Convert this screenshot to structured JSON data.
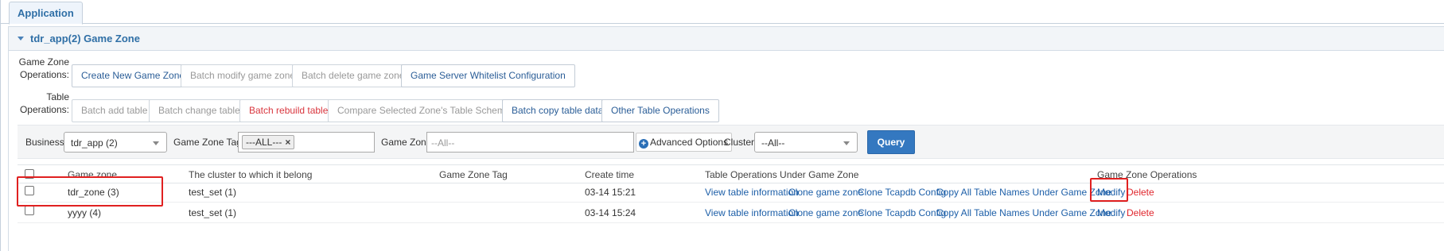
{
  "tab": {
    "label": "Application"
  },
  "panel": {
    "title": "tdr_app(2) Game Zone"
  },
  "game_zone_ops": {
    "label_line1": "Game Zone",
    "label_line2": "Operations:",
    "buttons": [
      {
        "label": "Create New Game Zone",
        "state": "enabled"
      },
      {
        "label": "Batch modify game zone",
        "state": "disabled"
      },
      {
        "label": "Batch delete game zone",
        "state": "disabled"
      },
      {
        "label": "Game Server Whitelist Configuration",
        "state": "enabled"
      }
    ]
  },
  "table_ops": {
    "label_line1": "Table",
    "label_line2": "Operations:",
    "buttons": [
      {
        "label": "Batch add table",
        "state": "disabled"
      },
      {
        "label": "Batch change table",
        "state": "disabled"
      },
      {
        "label": "Batch rebuild table",
        "state": "danger"
      },
      {
        "label": "Compare Selected Zone's Table Schemas",
        "state": "disabled"
      },
      {
        "label": "Batch copy table data",
        "state": "enabled"
      },
      {
        "label": "Other Table Operations",
        "state": "enabled"
      }
    ]
  },
  "filters": {
    "business_label": "Business:",
    "business_value": "tdr_app (2)",
    "tag_label": "Game Zone Tag:",
    "tag_chip": "---ALL---",
    "tag_chip_remove": "×",
    "zone_label": "Game Zone:",
    "zone_placeholder": "--All--",
    "advanced_label": "Advanced Options",
    "advanced_icon": "+",
    "cluster_label": "Cluster:",
    "cluster_value": "--All--",
    "query_label": "Query"
  },
  "table": {
    "headers": {
      "zone": "Game zone",
      "cluster": "The cluster to which it belong",
      "tag": "Game Zone Tag",
      "created": "Create time",
      "table_ops": "Table Operations Under Game Zone",
      "zone_ops": "Game Zone Operations"
    },
    "rows": [
      {
        "zone": "tdr_zone (3)",
        "cluster": "test_set (1)",
        "tag": "",
        "created": "03-14 15:21",
        "view": "View table information",
        "clone": "Clone game zone",
        "clone_tcapdb": "Clone Tcapdb Config",
        "copy_names": "Copy All Table Names Under Game Zone",
        "modify": "Modify",
        "delete": "Delete"
      },
      {
        "zone": "yyyy (4)",
        "cluster": "test_set (1)",
        "tag": "",
        "created": "03-14 15:24",
        "view": "View table information",
        "clone": "Clone game zone",
        "clone_tcapdb": "Clone Tcapdb Config",
        "copy_names": "Copy All Table Names Under Game Zone",
        "modify": "Modify",
        "delete": "Delete"
      }
    ]
  },
  "colors": {
    "link": "#1d5fa8",
    "danger": "#e0262d",
    "primary": "#3478c0",
    "highlight": "#e02020"
  }
}
